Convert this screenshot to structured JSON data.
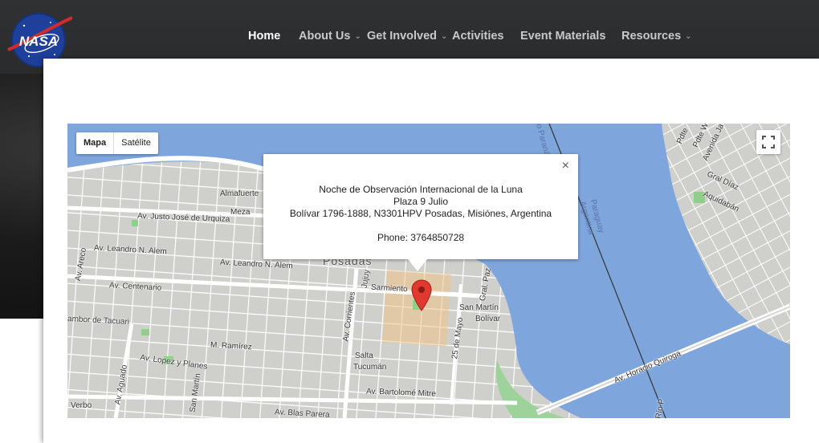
{
  "header": {
    "logo_text": "NASA",
    "nav": [
      {
        "label": "Home",
        "active": true,
        "dropdown": false
      },
      {
        "label": "About Us",
        "active": false,
        "dropdown": true
      },
      {
        "label": "Get Involved",
        "active": false,
        "dropdown": true
      },
      {
        "label": "Activities",
        "active": false,
        "dropdown": false
      },
      {
        "label": "Event Materials",
        "active": false,
        "dropdown": false
      },
      {
        "label": "Resources",
        "active": false,
        "dropdown": true
      }
    ]
  },
  "map": {
    "map_type_options": [
      "Mapa",
      "Satélite"
    ],
    "selected_map_type": "Mapa",
    "info": {
      "title": "Noche de Observación Internacional de la Luna",
      "place": "Plaza 9 Julio",
      "address": "Bolívar 1796-1888, N3301HPV Posadas, Misiónes, Argentina",
      "phone": "Phone: 3764850728",
      "close_symbol": "×"
    },
    "labels": {
      "city": "Posadas",
      "almafuerte": "Almafuerte",
      "meza": "Meza",
      "urquiza": "Av. Justo José de Urquiza",
      "alem1": "Av. Leandro N. Alem",
      "alem2": "Av. Leandro N. Alem",
      "centenario": "Av. Centenario",
      "tacuari": "ambor de Tacuari",
      "ramirez": "M. Ramírez",
      "lopez": "Av. Lopez y Planes",
      "aguado": "Av. Aguado",
      "sanmartin1": "San Martín",
      "verbo": "Verbo",
      "blas": "Av. Blas Parera",
      "mitre": "Av. Bartolomé Mitre",
      "corrientes": "Av. Corrientes",
      "jujuy": "Jujuy",
      "sarmiento": "Sarmiento",
      "salta": "Salta",
      "tucuman": "Tucumán",
      "mayo": "25 de Mayo",
      "sanmartin2": "San Martín",
      "bolivar": "Bolívar",
      "gralpaz": "Gral. Paz",
      "quiroga": "Av. Horacio Quiroga",
      "paraguay": "Paraguay",
      "argentina": "Argentina",
      "parana": "do Paraná",
      "gral_diaz": "Gral Díaz",
      "aquidaban": "Aquidabán",
      "avenida_ja": "Avenida Ja",
      "pdte": "Pdte",
      "pdte_w": "Pdte Wi",
      "areco": "Av. Areco",
      "rio": "Río P"
    }
  }
}
